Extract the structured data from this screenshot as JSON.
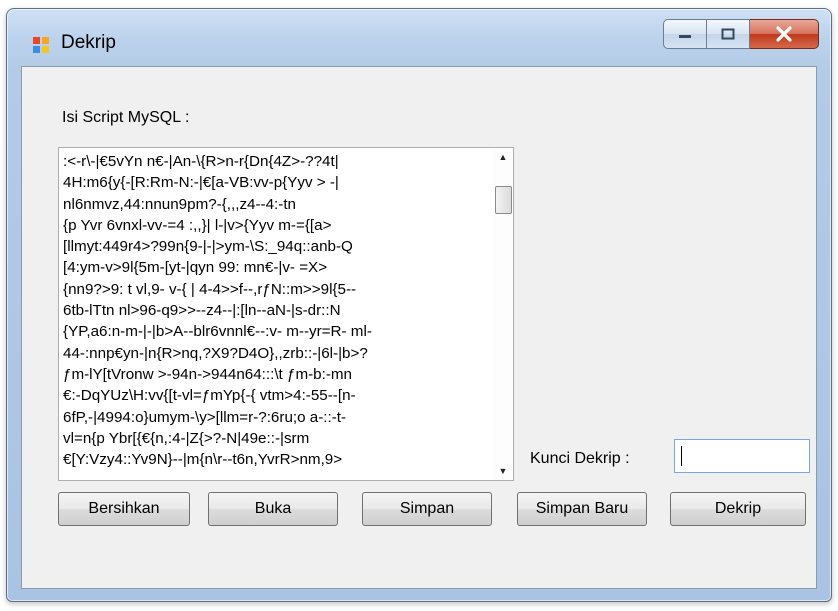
{
  "window": {
    "title": "Dekrip",
    "controls": {
      "minimize": "minimize-icon",
      "maximize": "maximize-icon",
      "close": "close-icon"
    }
  },
  "form": {
    "script_label": "Isi Script MySQL :",
    "script_text": ":<-r\\-|€5vYn n€-|An-\\{R>n-r{Dn{4Z>-??4t|\n4H:m6{y{-[R:Rm-N:-|€[a-VB:vv-p{Yyv > -|\nnl6nmvz,44:nnun9pm?-{,,,z4--4:-tn\n{p Yvr 6vnxl-vv-=4 :,,}| l-|v>{Yyv m-={[a>\n[llmyt:449r4>?99n{9-|-|>ym-\\S:_94q::anb-Q\n[4:ym-v>9l{5m-[yt-|qyn 99: mn€-|v- =X>\n{nn9?>9: t vl,9- v-{ | 4-4>>f--,rƒN::m>>9l{5--\n6tb-lTtn nl>96-q9>>--z4--|:[ln--aN-|s-dr::N\n{YP,a6:n-m-|-|b>A--blr6vnnl€--:v- m--yr=R- ml-\n44-:nnp€yn-|n{R>nq,?X9?D4O},,zrb::-|6l-|b>?\nƒm-lY[tVronw >-94n->944n64:::\\t ƒm-b:-mn\n€:-DqYUz\\H:vv{[t-vl=ƒmYp{-{ vtm>4:-55--[n-\n6fP,-|4994:o}umym-\\y>[llm=r-?:6ru;o a-::-t-\nvl=n{p Ybr[{€{n,:4-|Z{>?-N|49e::-|srm\n€[Y:Vzy4::Yv9N}--|m{n\\r--t6n,YvrR>nm,9>",
    "key_label": "Kunci Dekrip :",
    "key_value": ""
  },
  "buttons": {
    "clear": "Bersihkan",
    "open": "Buka",
    "save": "Simpan",
    "save_new": "Simpan Baru",
    "decrypt": "Dekrip"
  },
  "colors": {
    "window_frame": "#b4cbe6",
    "client_bg": "#f0f0f0",
    "close_button": "#c0381c",
    "input_border": "#7aa7d8"
  }
}
